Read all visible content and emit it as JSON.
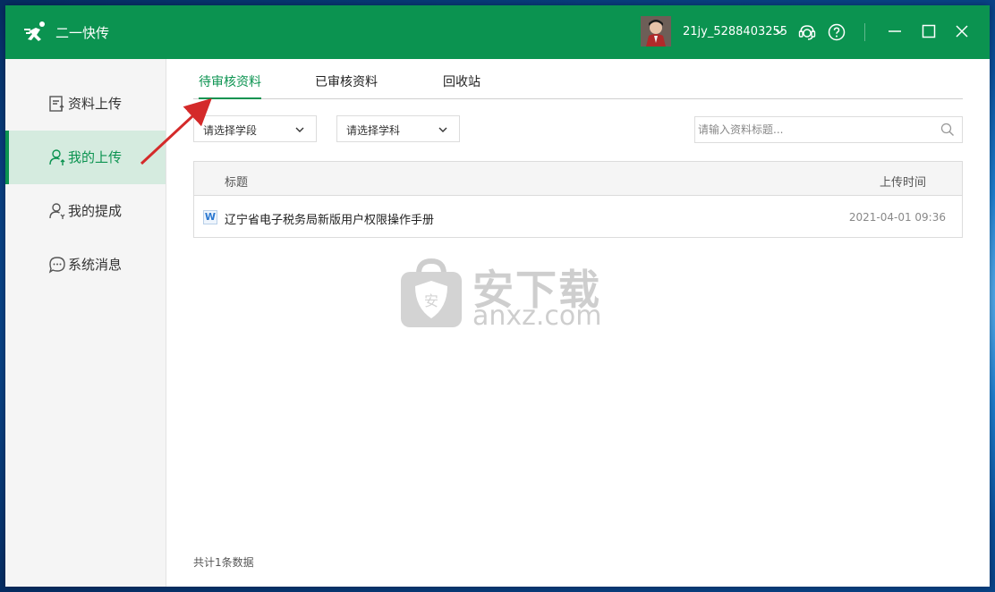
{
  "app": {
    "name": "二一快传",
    "username": "21jy_5288403255"
  },
  "sidebar": {
    "items": [
      {
        "label": "资料上传",
        "icon": "upload-doc-icon",
        "active": false
      },
      {
        "label": "我的上传",
        "icon": "user-upload-icon",
        "active": true
      },
      {
        "label": "我的提成",
        "icon": "user-commission-icon",
        "active": false
      },
      {
        "label": "系统消息",
        "icon": "message-icon",
        "active": false
      }
    ]
  },
  "tabs": [
    {
      "label": "待审核资料",
      "active": true
    },
    {
      "label": "已审核资料",
      "active": false
    },
    {
      "label": "回收站",
      "active": false
    }
  ],
  "filters": {
    "stage_select": "请选择学段",
    "subject_select": "请选择学科",
    "search_placeholder": "请输入资料标题..."
  },
  "table": {
    "headers": {
      "title": "标题",
      "time": "上传时间"
    },
    "rows": [
      {
        "file_type": "W",
        "title": "辽宁省电子税务局新版用户权限操作手册",
        "time": "2021-04-01 09:36"
      }
    ]
  },
  "footer": {
    "count_text": "共计1条数据"
  },
  "watermark": {
    "text": "安下载",
    "sub": "anxz.com"
  },
  "colors": {
    "brand": "#0b9350",
    "active_bg": "#d5ebdf",
    "annotation_arrow": "#d42a2a"
  }
}
